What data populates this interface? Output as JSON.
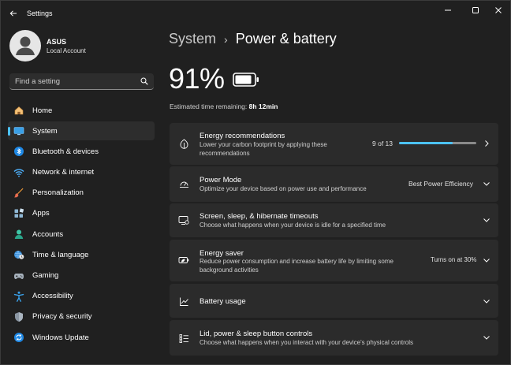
{
  "window": {
    "title": "Settings"
  },
  "profile": {
    "name": "ASUS",
    "account": "Local Account"
  },
  "search": {
    "placeholder": "Find a setting"
  },
  "nav": [
    {
      "id": "home",
      "label": "Home",
      "icon": "home-icon",
      "active": false
    },
    {
      "id": "system",
      "label": "System",
      "icon": "system-icon",
      "active": true
    },
    {
      "id": "bluetooth",
      "label": "Bluetooth & devices",
      "icon": "bluetooth-icon",
      "active": false
    },
    {
      "id": "network",
      "label": "Network & internet",
      "icon": "wifi-icon",
      "active": false
    },
    {
      "id": "personalization",
      "label": "Personalization",
      "icon": "brush-icon",
      "active": false
    },
    {
      "id": "apps",
      "label": "Apps",
      "icon": "apps-icon",
      "active": false
    },
    {
      "id": "accounts",
      "label": "Accounts",
      "icon": "person-icon",
      "active": false
    },
    {
      "id": "time",
      "label": "Time & language",
      "icon": "globe-clock-icon",
      "active": false
    },
    {
      "id": "gaming",
      "label": "Gaming",
      "icon": "gamepad-icon",
      "active": false
    },
    {
      "id": "accessibility",
      "label": "Accessibility",
      "icon": "accessibility-icon",
      "active": false
    },
    {
      "id": "privacy",
      "label": "Privacy & security",
      "icon": "shield-icon",
      "active": false
    },
    {
      "id": "update",
      "label": "Windows Update",
      "icon": "update-icon",
      "active": false
    }
  ],
  "breadcrumb": {
    "parent": "System",
    "separator": "›",
    "current": "Power & battery"
  },
  "battery": {
    "percent": "91%",
    "level": 0.91,
    "estimate_label": "Estimated time remaining:",
    "estimate_value": "8h 12min"
  },
  "cards": {
    "energy_rec": {
      "title": "Energy recommendations",
      "desc": "Lower your carbon footprint by applying these recommendations",
      "value": "9 of 13",
      "progress": 0.69
    },
    "power_mode": {
      "title": "Power Mode",
      "desc": "Optimize your device based on power use and performance",
      "value": "Best Power Efficiency"
    },
    "screen_sleep": {
      "title": "Screen, sleep, & hibernate timeouts",
      "desc": "Choose what happens when your device is idle for a specified time"
    },
    "energy_saver": {
      "title": "Energy saver",
      "desc": "Reduce power consumption and increase battery life by limiting some background activities",
      "value": "Turns on at 30%"
    },
    "battery_usage": {
      "title": "Battery usage"
    },
    "lid_power": {
      "title": "Lid, power & sleep button controls",
      "desc": "Choose what happens when you interact with your device's physical controls"
    }
  },
  "colors": {
    "accent": "#4cc2ff",
    "window_bg": "#202020",
    "card_bg": "#2b2b2b",
    "active_nav_bg": "#2d2d2d"
  }
}
